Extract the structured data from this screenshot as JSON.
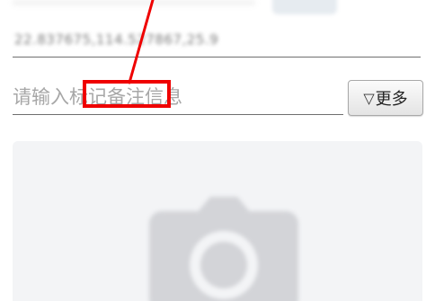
{
  "location": {
    "coords_text": "22.837675,114.527867,25.9"
  },
  "note": {
    "placeholder_prefix": "请输入",
    "placeholder_highlight": "标记备注",
    "placeholder_suffix": "信息"
  },
  "more_button": {
    "icon": "triangle-down-icon",
    "icon_glyph": "▽",
    "label": "更多"
  },
  "photo": {
    "icon": "camera-icon"
  },
  "colors": {
    "highlight": "#ef0000",
    "placeholder": "#a7a7a7",
    "panel": "#f3f4f6"
  }
}
